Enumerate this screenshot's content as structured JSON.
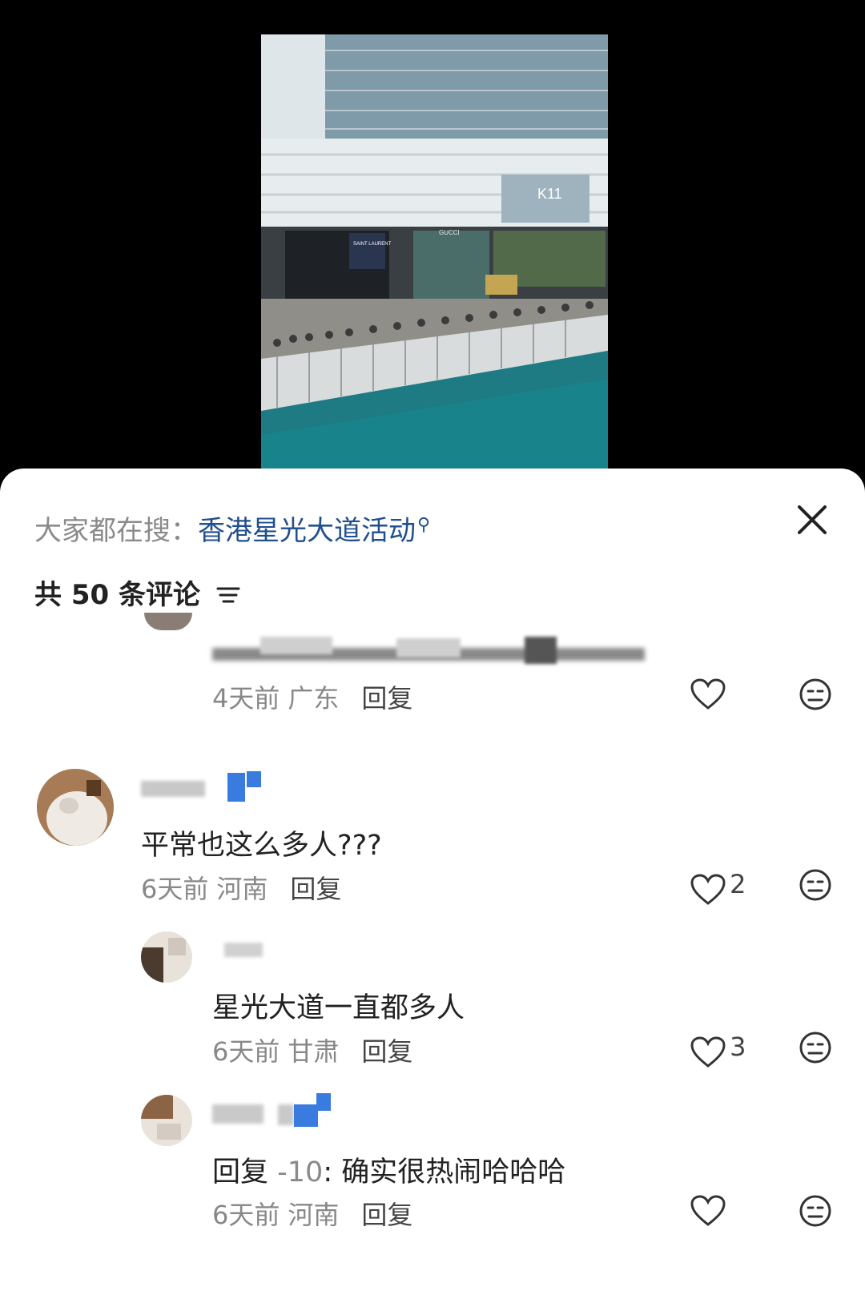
{
  "search": {
    "prefix": "大家都在搜：",
    "query": "香港星光大道活动"
  },
  "comment_count_label": "共 50 条评论",
  "comments": [
    {
      "text": "",
      "time": "4天前",
      "location": "广东",
      "reply": "回复",
      "likes": ""
    },
    {
      "text": "平常也这么多人???",
      "time": "6天前",
      "location": "河南",
      "reply": "回复",
      "likes": "2"
    },
    {
      "text": "星光大道一直都多人",
      "time": "6天前",
      "location": "甘肃",
      "reply": "回复",
      "likes": "3"
    },
    {
      "reply_prefix": "回复",
      "reply_to": "-10",
      "text": ": 确实很热闹哈哈哈",
      "time": "6天前",
      "location": "河南",
      "reply": "回复",
      "likes": ""
    }
  ],
  "photo_signs": {
    "brand1": "SAINT LAURENT",
    "brand2": "GUCCI",
    "brand3": "K11"
  },
  "colors": {
    "accent": "#1f4f8f",
    "badge": "#3a7be0"
  }
}
